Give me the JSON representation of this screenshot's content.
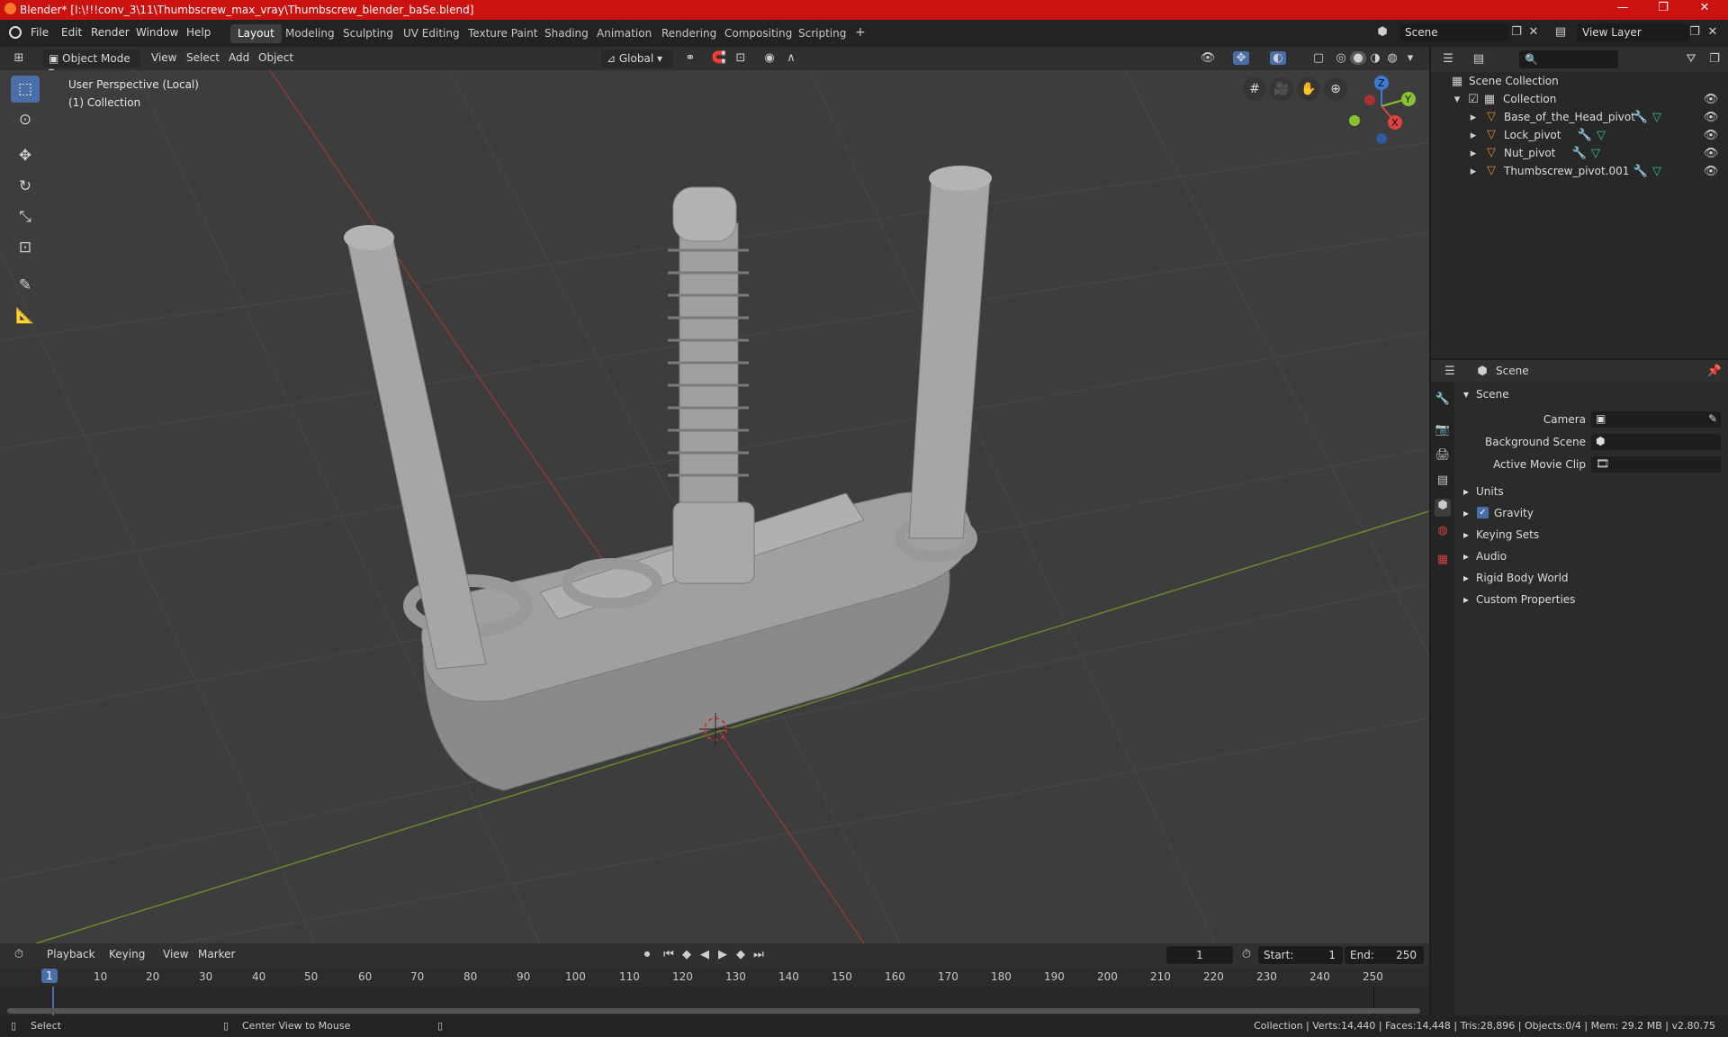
{
  "window": {
    "title": "Blender* [I:\\!!!conv_3\\11\\Thumbscrew_max_vray\\Thumbscrew_blender_baSe.blend]",
    "minimize": "—",
    "maximize": "❐",
    "close": "✕"
  },
  "menu": [
    "File",
    "Edit",
    "Render",
    "Window",
    "Help"
  ],
  "workspaces": [
    "Layout",
    "Modeling",
    "Sculpting",
    "UV Editing",
    "Texture Paint",
    "Shading",
    "Animation",
    "Rendering",
    "Compositing",
    "Scripting"
  ],
  "add_workspace": "+",
  "scene_field": "Scene",
  "view_layer_field": "View Layer",
  "viewport_header": {
    "mode": "Object Mode",
    "menus": [
      "View",
      "Select",
      "Add",
      "Object"
    ],
    "orientation": "Global"
  },
  "viewport": {
    "info_line1": "User Perspective (Local)",
    "info_line2": "(1) Collection",
    "gizmo_axes": [
      "Z",
      "Y",
      "X"
    ]
  },
  "outliner": {
    "root": "Scene Collection",
    "collection": "Collection",
    "items": [
      "Base_of_the_Head_pivot",
      "Lock_pivot",
      "Nut_pivot",
      "Thumbscrew_pivot.001"
    ]
  },
  "properties": {
    "header": "Scene",
    "panel": "Scene",
    "fields": [
      {
        "label": "Camera"
      },
      {
        "label": "Background Scene"
      },
      {
        "label": "Active Movie Clip"
      }
    ],
    "sections": [
      "Units",
      "Gravity",
      "Keying Sets",
      "Audio",
      "Rigid Body World",
      "Custom Properties"
    ]
  },
  "timeline": {
    "menus": [
      "Playback",
      "Keying",
      "View",
      "Marker"
    ],
    "current_frame": "1",
    "start_label": "Start:",
    "start": "1",
    "end_label": "End:",
    "end": "250",
    "ticks": [
      "1",
      "10",
      "20",
      "30",
      "40",
      "50",
      "60",
      "70",
      "80",
      "90",
      "100",
      "110",
      "120",
      "130",
      "140",
      "150",
      "160",
      "170",
      "180",
      "190",
      "200",
      "210",
      "220",
      "230",
      "240",
      "250"
    ]
  },
  "status": {
    "select": "Select",
    "center": "Center View to Mouse",
    "stats": "Collection | Verts:14,440 | Faces:14,448 | Tris:28,896 | Objects:0/4 | Mem: 29.2 MB | v2.80.75"
  }
}
